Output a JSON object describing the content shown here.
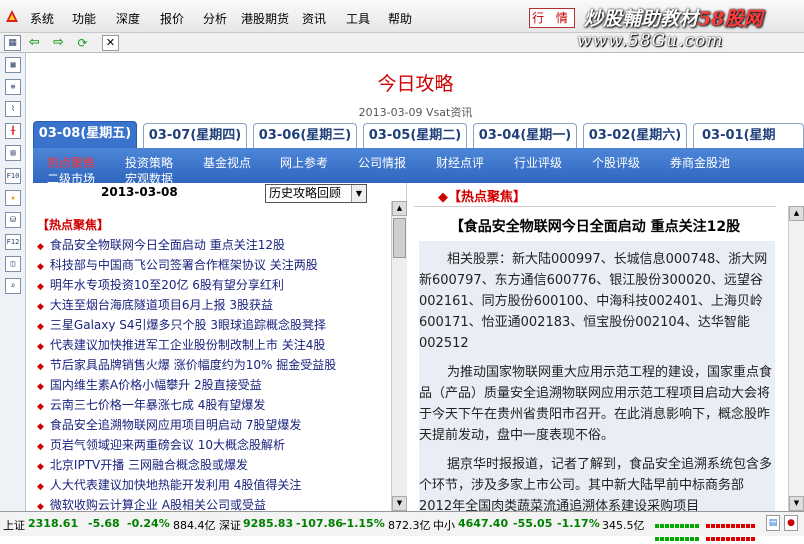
{
  "menu": {
    "items": [
      "系统",
      "功能",
      "深度",
      "报价",
      "分析",
      "港股期货",
      "资讯",
      "工具",
      "帮助"
    ],
    "quote_button": "行 情"
  },
  "watermark": {
    "line1_white": "炒股輔助教材",
    "line1_red": "58股网",
    "line2": "www.58Gu.com"
  },
  "sidebar": {
    "icons": [
      "list-icon",
      "grid-icon",
      "chart-icon",
      "candlestick-icon",
      "table-icon",
      "f10-icon",
      "favorite-icon",
      "bag-icon",
      "f12-icon",
      "monitor-icon",
      "search-icon"
    ]
  },
  "sidebar_labels": [
    "▦",
    "≡",
    "⌇",
    "╫",
    "▤",
    "F10",
    "★",
    "⛁",
    "F12",
    "◫",
    "⌕"
  ],
  "page": {
    "title": "今日攻略",
    "subtitle": "2013-03-09 Vsat资讯"
  },
  "date_tabs": [
    {
      "label": "03-08(星期五)",
      "active": true
    },
    {
      "label": "03-07(星期四)",
      "active": false
    },
    {
      "label": "03-06(星期三)",
      "active": false
    },
    {
      "label": "03-05(星期二)",
      "active": false
    },
    {
      "label": "03-04(星期一)",
      "active": false
    },
    {
      "label": "03-02(星期六)",
      "active": false
    },
    {
      "label": "03-01(星期",
      "active": false
    }
  ],
  "categories": {
    "row1": [
      "热点聚焦",
      "投资策略",
      "基金视点",
      "网上参考",
      "公司情报",
      "财经点评",
      "行业评级",
      "个股评级",
      "券商金股池"
    ],
    "row2": [
      "二级市场",
      "宏观数据"
    ],
    "active": "热点聚焦"
  },
  "left_panel": {
    "date": "2013-03-08",
    "history_select": "历史攻略回顾",
    "section_title": "【热点聚焦】",
    "news": [
      "食品安全物联网今日全面启动 重点关注12股",
      "科技部与中国商飞公司签署合作框架协议 关注两股",
      "明年水专项投资10至20亿 6股有望分享红利",
      "大连至烟台海底隧道项目6月上报 3股获益",
      "三星Galaxy S4引爆多只个股 3眼球追踪概念股凳择",
      "代表建议加快推进军工企业股份制改制上市 关注4股",
      "节后家具品牌销售火爆 涨价幅度约为10% 掘金受益股",
      "国内维生素A价格小幅攀升 2股直接受益",
      "云南三七价格一年暴涨七成 4股有望爆发",
      "食品安全追溯物联网应用项目明启动 7股望爆发",
      "页岩气领域迎来两重磅会议 10大概念股解析",
      "北京IPTV开播 三网融合概念股或爆发",
      "人大代表建议加快地热能开发利用 4股值得关注",
      "微软收购云计算企业 A股相关公司或受益"
    ]
  },
  "right_panel": {
    "section_title": "◆【热点聚焦】",
    "article_title": "【食品安全物联网今日全面启动 重点关注12股",
    "paragraphs": [
      "相关股票：新大陆000997、长城信息000748、浙大网新600797、东方通信600776、银江股份300020、远望谷002161、同方股份600100、中海科技002401、上海贝岭600171、怡亚通002183、恒宝股份002104、达华智能002512",
      "为推动国家物联网重大应用示范工程的建设，国家重点食品（产品）质量安全追溯物联网应用示范工程项目启动大会将于今天下午在贵州省贵阳市召开。在此消息影响下，概念股昨天提前发动，盘中一度表现不俗。",
      "据京华时报报道，记者了解到，食品安全追溯系统包含多个环节，涉及多家上市公司。其中新大陆早前中标商务部2012年全国肉类蔬菜流通追溯体系建设采购项目"
    ]
  },
  "status": {
    "sh_label": "上证",
    "sh_index": "2318.61",
    "sh_change": "-5.68",
    "sh_pct": "-0.24%",
    "sh_amount": "884.4亿",
    "sz_label": "深证",
    "sz_index": "9285.83",
    "sz_change": "-107.86",
    "sz_pct": "-1.15%",
    "sz_amount": "872.3亿",
    "zx_label": "中小",
    "zx_index": "4647.40",
    "zx_change": "-55.05",
    "zx_pct": "-1.17%",
    "zx_amount": "345.5亿"
  },
  "colors": {
    "accent_blue": "#3a73cc",
    "title_red": "#d00000",
    "link_blue": "#1a237e",
    "status_green": "#008000"
  }
}
